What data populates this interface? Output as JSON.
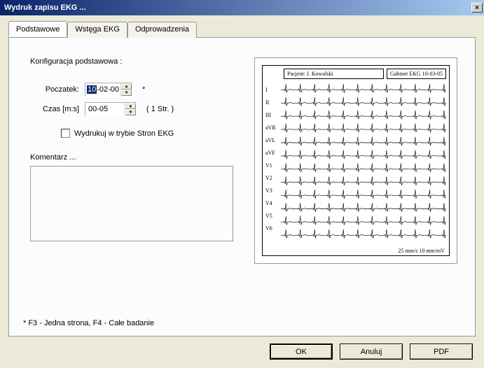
{
  "window": {
    "title": "Wydruk zapisu EKG ...",
    "close": "×"
  },
  "tabs": {
    "basic": "Podstawowe",
    "strip": "Wstęga EKG",
    "leads": "Odprowadzenia"
  },
  "basic": {
    "section_title": "Konfiguracja podstawowa :",
    "start_label": "Poczatek:",
    "start_value_sel": "10",
    "start_value_rest": "-02-00",
    "star": "*",
    "time_label": "Czas [m:s]",
    "time_value": "00-05",
    "pages": "( 1 Str. )",
    "checkbox_label": "Wydrukuj w trybie Stron EKG",
    "comment_label": "Komentarz ...",
    "hint": "*  F3 - Jedna strona,    F4 - Całe badanie"
  },
  "preview": {
    "patient": "Pacjent: J. Kowalski",
    "clinic": "Gabinet   EKG 10-03-05",
    "leads": [
      "I",
      "II",
      "III",
      "aVR",
      "aVL",
      "aVF",
      "V1",
      "V2",
      "V3",
      "V4",
      "V5",
      "V6"
    ],
    "scale": "25 mm/s  10 mm/mV"
  },
  "buttons": {
    "ok": "OK",
    "cancel": "Anuluj",
    "pdf": "PDF"
  }
}
